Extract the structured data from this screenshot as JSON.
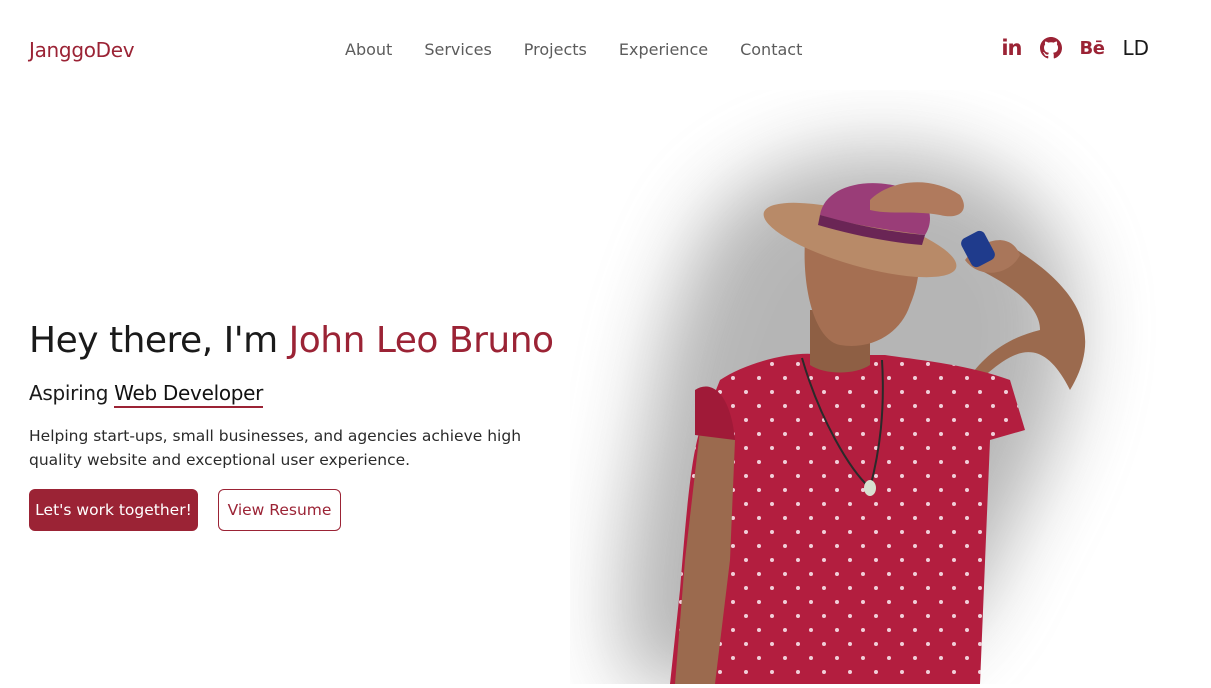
{
  "brand": {
    "logo": "JanggoDev"
  },
  "nav": {
    "items": [
      {
        "label": "About"
      },
      {
        "label": "Services"
      },
      {
        "label": "Projects"
      },
      {
        "label": "Experience"
      },
      {
        "label": "Contact"
      }
    ]
  },
  "social": {
    "linkedin": "in",
    "behance": "Bē",
    "theme_toggle": "LD"
  },
  "hero": {
    "greeting": "Hey there, I'm ",
    "name": "John Leo Bruno",
    "subtitle_prefix": "Aspiring ",
    "role": "Web Developer",
    "description": "Helping start-ups, small businesses, and agencies achieve high quality website and exceptional user experience.",
    "primary_cta": "Let's work together!",
    "secondary_cta": "View Resume"
  },
  "colors": {
    "accent": "#9b2335",
    "text": "#1a1a1a",
    "nav_text": "#5c5c5c",
    "background": "#ffffff"
  },
  "icons": [
    "linkedin-icon",
    "github-icon",
    "behance-icon",
    "theme-toggle-icon"
  ]
}
